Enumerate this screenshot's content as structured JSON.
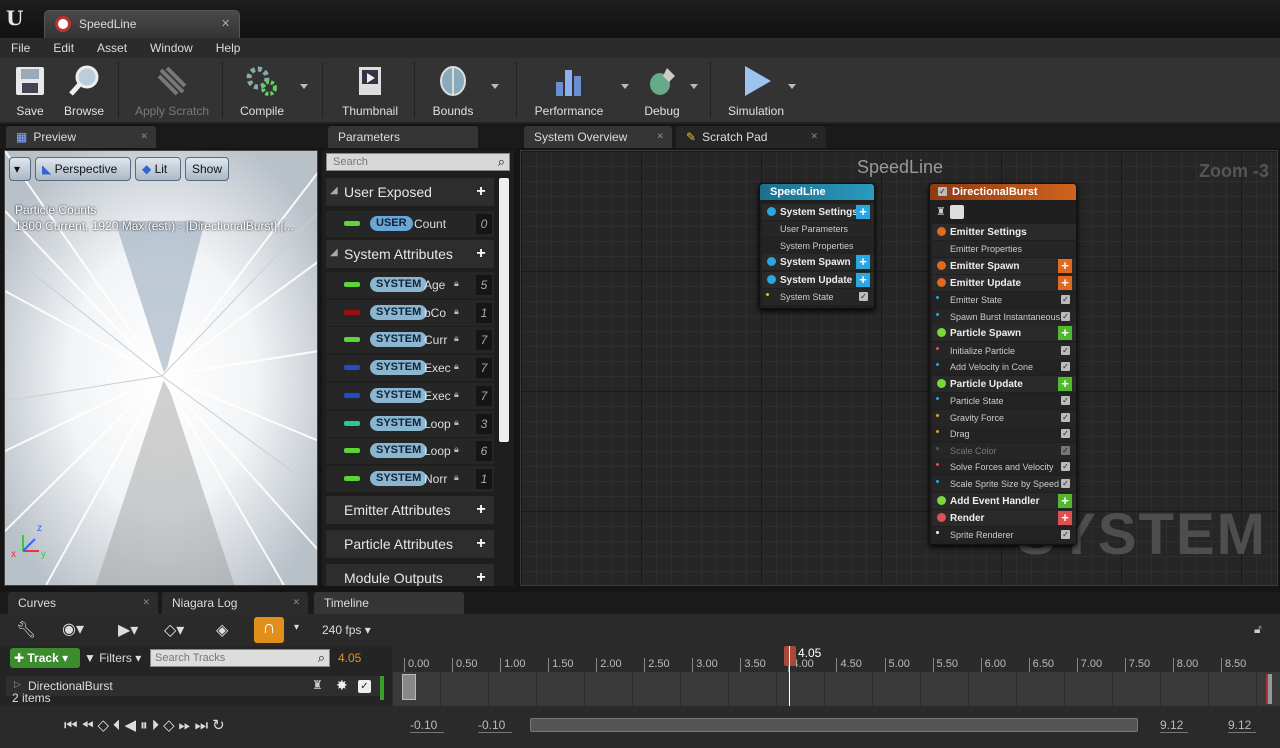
{
  "window": {
    "tab_title": "SpeedLine"
  },
  "menu": [
    "File",
    "Edit",
    "Asset",
    "Window",
    "Help"
  ],
  "toolbar": {
    "save": "Save",
    "browse": "Browse",
    "apply_scratch": "Apply Scratch",
    "compile": "Compile",
    "thumbnail": "Thumbnail",
    "bounds": "Bounds",
    "performance": "Performance",
    "debug": "Debug",
    "simulation": "Simulation"
  },
  "panels": {
    "preview": "Preview",
    "parameters": "Parameters",
    "system_overview": "System Overview",
    "scratch_pad": "Scratch Pad"
  },
  "preview": {
    "perspective": "Perspective",
    "lit": "Lit",
    "show": "Show",
    "counts_title": "Particle Counts",
    "counts_line": "1800 Current, 1920 Max (est.) - [DirectionalBurst] [..."
  },
  "parameters": {
    "search_placeholder": "Search",
    "user_exposed": "User Exposed",
    "user_rows": [
      {
        "tag": "USER",
        "name": "Count",
        "value": "0",
        "color": "#5fd33a"
      }
    ],
    "system_attributes": "System Attributes",
    "system_rows": [
      {
        "tag": "SYSTEM",
        "name": "Age",
        "value": "5",
        "color": "#5fd33a"
      },
      {
        "tag": "SYSTEM",
        "name": "bCo",
        "value": "1",
        "color": "#9a1010"
      },
      {
        "tag": "SYSTEM",
        "name": "Curr",
        "value": "7",
        "color": "#5fd33a"
      },
      {
        "tag": "SYSTEM",
        "name": "Exec",
        "value": "7",
        "color": "#1f4fc8"
      },
      {
        "tag": "SYSTEM",
        "name": "Exec",
        "value": "7",
        "color": "#1f4fc8"
      },
      {
        "tag": "SYSTEM",
        "name": "Loop",
        "value": "3",
        "color": "#28c8a0"
      },
      {
        "tag": "SYSTEM",
        "name": "Loop",
        "value": "6",
        "color": "#5fd33a"
      },
      {
        "tag": "SYSTEM",
        "name": "Norr",
        "value": "1",
        "color": "#5fd33a"
      }
    ],
    "emitter_attributes": "Emitter Attributes",
    "particle_attributes": "Particle Attributes",
    "module_outputs": "Module Outputs"
  },
  "graph": {
    "title": "SpeedLine",
    "zoom": "Zoom -3",
    "watermark": "SYSTEM",
    "system_node": {
      "title": "SpeedLine",
      "rows": [
        {
          "label": "System Settings",
          "big": true,
          "plus": true,
          "dot": "#29a7e0"
        },
        {
          "label": "User Parameters"
        },
        {
          "label": "System Properties"
        },
        {
          "label": "System Spawn",
          "big": true,
          "plus": true,
          "dot": "#29a7e0"
        },
        {
          "label": "System Update",
          "big": true,
          "plus": true,
          "dot": "#29a7e0"
        },
        {
          "label": "System State",
          "check": true,
          "dot": "#e0c020"
        }
      ]
    },
    "emitter_node": {
      "title": "DirectionalBurst",
      "rows": [
        {
          "label": "Emitter Settings",
          "big": true,
          "dot": "#e06a20"
        },
        {
          "label": "Emitter Properties"
        },
        {
          "label": "Emitter Spawn",
          "big": true,
          "plus": true,
          "pluscolor": "#e06a20",
          "dot": "#e06a20"
        },
        {
          "label": "Emitter Update",
          "big": true,
          "plus": true,
          "pluscolor": "#e06a20",
          "dot": "#e06a20"
        },
        {
          "label": "Emitter State",
          "check": true,
          "dot": "#29a7e0"
        },
        {
          "label": "Spawn Burst Instantaneous",
          "check": true,
          "dot": "#29a7e0"
        },
        {
          "label": "Particle Spawn",
          "big": true,
          "plus": true,
          "pluscolor": "#52b82e",
          "dot": "#7ad83a"
        },
        {
          "label": "Initialize Particle",
          "check": true,
          "dot": "#e05050"
        },
        {
          "label": "Add Velocity in Cone",
          "check": true,
          "dot": "#29a7e0"
        },
        {
          "label": "Particle Update",
          "big": true,
          "plus": true,
          "pluscolor": "#52b82e",
          "dot": "#7ad83a"
        },
        {
          "label": "Particle State",
          "check": true,
          "dot": "#29a7e0"
        },
        {
          "label": "Gravity Force",
          "check": true,
          "dot": "#e0a020"
        },
        {
          "label": "Drag",
          "check": true,
          "dot": "#e0a020"
        },
        {
          "label": "Scale Color",
          "check": true,
          "dim": true,
          "dot": "#555"
        },
        {
          "label": "Solve Forces and Velocity",
          "check": true,
          "dot": "#e05050"
        },
        {
          "label": "Scale Sprite Size by Speed",
          "check": true,
          "dot": "#29a7e0"
        },
        {
          "label": "Add Event Handler",
          "big": true,
          "plus": true,
          "pluscolor": "#52b82e",
          "dot": "#7ad83a"
        },
        {
          "label": "Render",
          "big": true,
          "plus": true,
          "pluscolor": "#e05050",
          "dot": "#e05050"
        },
        {
          "label": "Sprite Renderer",
          "check": true,
          "dot": "#eee"
        }
      ]
    }
  },
  "bottom": {
    "tabs": [
      "Curves",
      "Niagara Log",
      "Timeline"
    ],
    "fps": "240 fps",
    "track_button": "Track",
    "filters": "Filters",
    "search_tracks_placeholder": "Search Tracks",
    "current_time": "4.05",
    "playhead": "4.05",
    "track_name": "DirectionalBurst",
    "items_count": "2 items",
    "ticks": [
      "0.00",
      "0.50",
      "1.00",
      "1.50",
      "2.00",
      "2.50",
      "3.00",
      "3.50",
      "4.00",
      "4.50",
      "5.00",
      "5.50",
      "6.00",
      "6.50",
      "7.00",
      "7.50",
      "8.00",
      "8.50"
    ],
    "range_start_a": "-0.10",
    "range_start_b": "-0.10",
    "range_end_a": "9.12",
    "range_end_b": "9.12"
  }
}
